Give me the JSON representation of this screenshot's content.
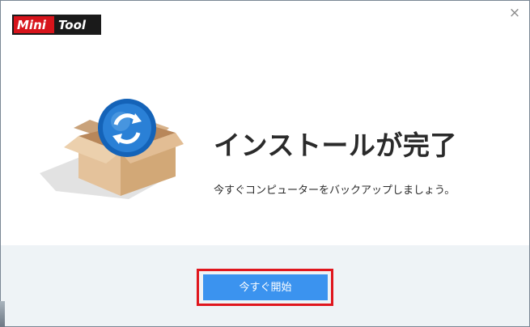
{
  "logo": {
    "word1": "Mini",
    "word2": "Tool"
  },
  "window": {
    "close_glyph": "×"
  },
  "main": {
    "title": "インストールが完了",
    "subtitle": "今すぐコンピューターをバックアップしましょう。"
  },
  "footer": {
    "start_button_label": "今すぐ開始"
  },
  "icons": {
    "close": "close-icon",
    "product": "box-sync-icon"
  },
  "colors": {
    "accent": "#3b93ef",
    "highlight_border": "#e0161d",
    "footer_bg": "#eef3f6",
    "logo_red": "#d7141b"
  }
}
